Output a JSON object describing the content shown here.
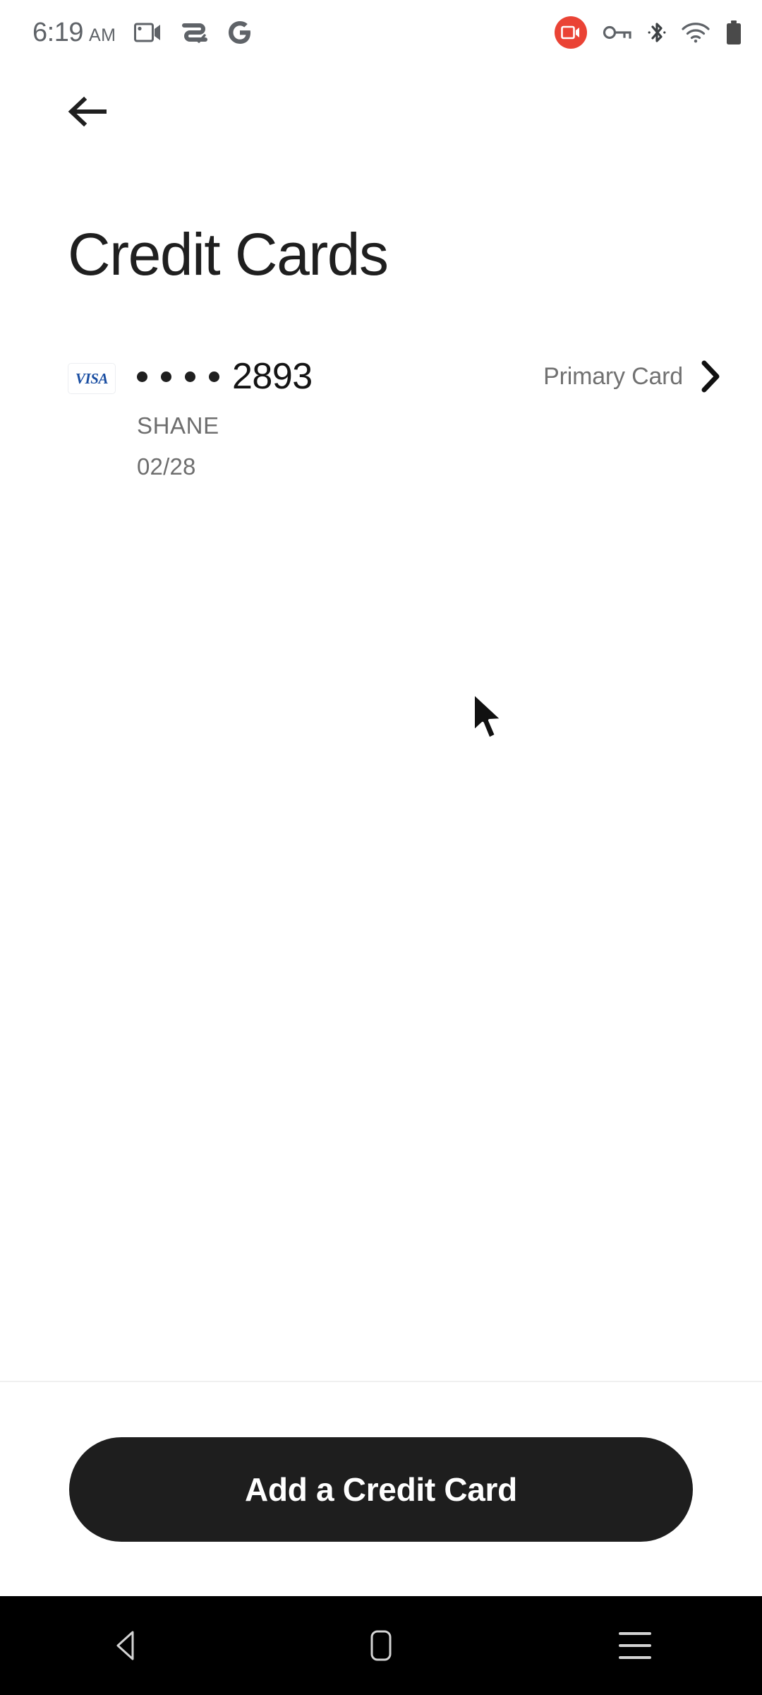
{
  "status_bar": {
    "time": "6:19",
    "meridiem": "AM",
    "notification_icons": [
      "screen-record-icon",
      "adaptive-charging-icon",
      "google-icon"
    ],
    "system_icons": [
      "screen-recording-active-badge",
      "vpn-key-icon",
      "bluetooth-icon",
      "wifi-icon",
      "battery-icon"
    ],
    "recording_badge_color": "#ea4335",
    "icon_color": "#5f6368"
  },
  "app_bar": {
    "back_label": "Back"
  },
  "page": {
    "title": "Credit Cards"
  },
  "cards": [
    {
      "brand": "VISA",
      "brand_color": "#1a4ea2",
      "masked_prefix": "• • • •",
      "last4": "2893",
      "holder": "SHANE",
      "expiry": "02/28",
      "badge": "Primary Card"
    }
  ],
  "footer": {
    "add_card_label": "Add a Credit Card",
    "button_color": "#1e1e1e"
  },
  "nav_bar": {
    "back_label": "Back",
    "home_label": "Home",
    "recents_label": "Recent apps"
  }
}
